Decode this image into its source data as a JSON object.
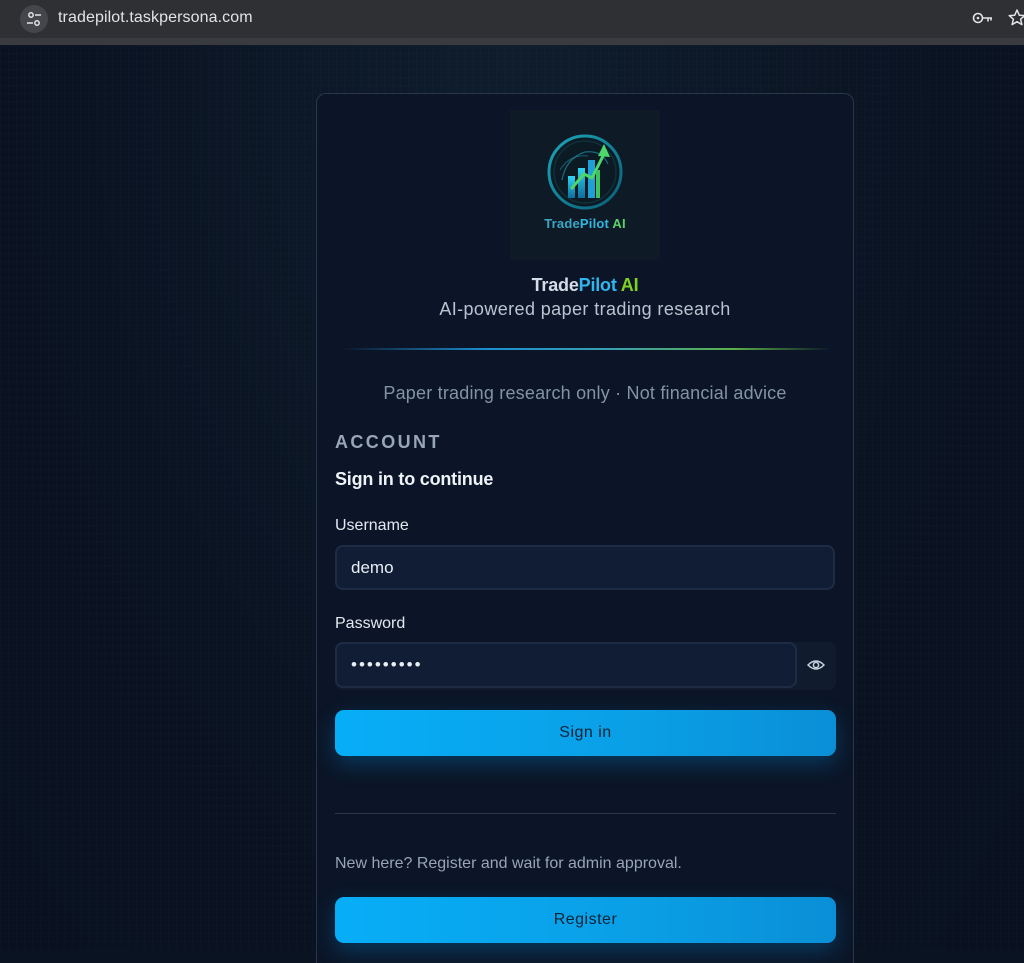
{
  "browser": {
    "url": "tradepilot.taskpersona.com"
  },
  "logo": {
    "word_trade": "Trade",
    "word_pilot": "Pilot",
    "word_ai": " AI"
  },
  "brand": {
    "trade": "Trade",
    "pilot": "Pilot",
    "ai": " AI",
    "tagline": "AI-powered paper trading research",
    "disclaimer": "Paper trading research only · Not financial advice"
  },
  "account": {
    "kicker": "ACCOUNT",
    "title": "Sign in to continue",
    "username_label": "Username",
    "username_value": "demo",
    "password_label": "Password",
    "password_value": "•••••••••",
    "signin_label": "Sign in",
    "register_note": "New here? Register and wait for admin approval.",
    "register_label": "Register"
  },
  "colors": {
    "accent": "#07aef7",
    "brand_pilot": "#2fb6ee",
    "brand_ai": "#7ed321",
    "background": "#0a1322"
  },
  "icons": {
    "site_info": "tune-icon",
    "password_manager": "key-icon",
    "bookmark": "star-icon",
    "password_toggle": "eye-icon"
  }
}
